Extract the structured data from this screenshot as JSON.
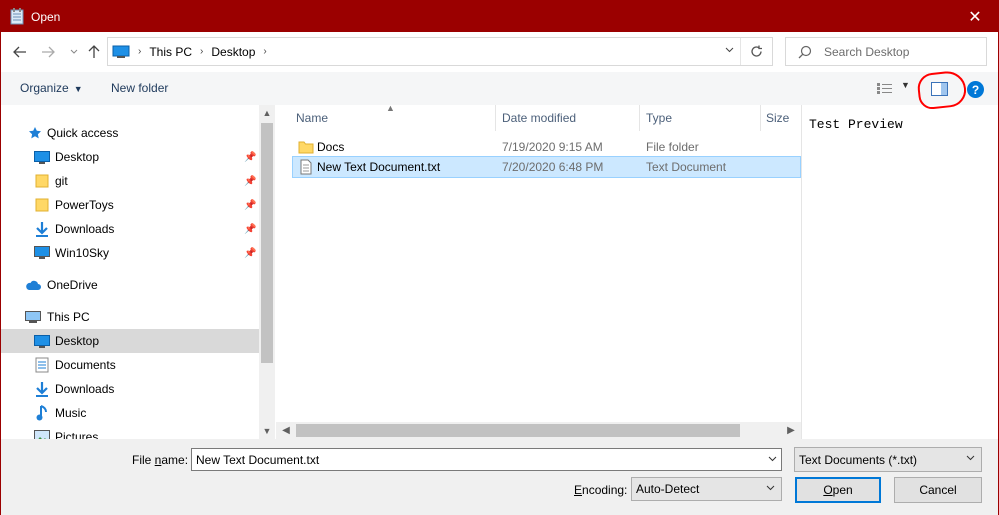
{
  "window": {
    "title": "Open",
    "close_glyph": "✕"
  },
  "address": {
    "crumbs": [
      "This PC",
      "Desktop"
    ],
    "search_placeholder": "Search Desktop"
  },
  "toolbar": {
    "organize": "Organize",
    "new_folder": "New folder",
    "help": "?"
  },
  "nav": {
    "items": [
      {
        "label": "Quick access",
        "icon": "star-icon"
      },
      {
        "label": "Desktop",
        "icon": "desktop-icon",
        "pinned": true
      },
      {
        "label": "git",
        "icon": "folder-icon",
        "pinned": true
      },
      {
        "label": "PowerToys",
        "icon": "folder-icon",
        "pinned": true
      },
      {
        "label": "Downloads",
        "icon": "download-icon",
        "pinned": true
      },
      {
        "label": "Win10Sky",
        "icon": "monitor-icon",
        "pinned": true
      },
      {
        "label": "OneDrive",
        "icon": "cloud-icon"
      },
      {
        "label": "This PC",
        "icon": "pc-icon"
      },
      {
        "label": "Desktop",
        "icon": "desktop-icon",
        "selected": true
      },
      {
        "label": "Documents",
        "icon": "documents-icon"
      },
      {
        "label": "Downloads",
        "icon": "download-icon"
      },
      {
        "label": "Music",
        "icon": "music-icon"
      },
      {
        "label": "Pictures",
        "icon": "pictures-icon"
      }
    ]
  },
  "filelist": {
    "columns": [
      "Name",
      "Date modified",
      "Type",
      "Size"
    ],
    "rows": [
      {
        "name": "Docs",
        "date": "7/19/2020 9:15 AM",
        "type": "File folder",
        "icon": "folder-icon"
      },
      {
        "name": "New Text Document.txt",
        "date": "7/20/2020 6:48 PM",
        "type": "Text Document",
        "icon": "text-file-icon",
        "selected": true
      }
    ]
  },
  "preview": {
    "text": "Test Preview"
  },
  "bottom": {
    "file_name_label_pre": "File ",
    "file_name_label_u": "n",
    "file_name_label_post": "ame:",
    "file_name_value": "New Text Document.txt",
    "filter_value": "Text Documents (*.txt)",
    "encoding_label_u": "E",
    "encoding_label_post": "ncoding:",
    "encoding_value": "Auto-Detect",
    "open_u": "O",
    "open_post": "pen",
    "cancel": "Cancel"
  },
  "colors": {
    "titlebar": "#9b0000",
    "accent": "#0078d7",
    "highlight_ring": "#ff0000",
    "selection": "#cce8ff"
  }
}
